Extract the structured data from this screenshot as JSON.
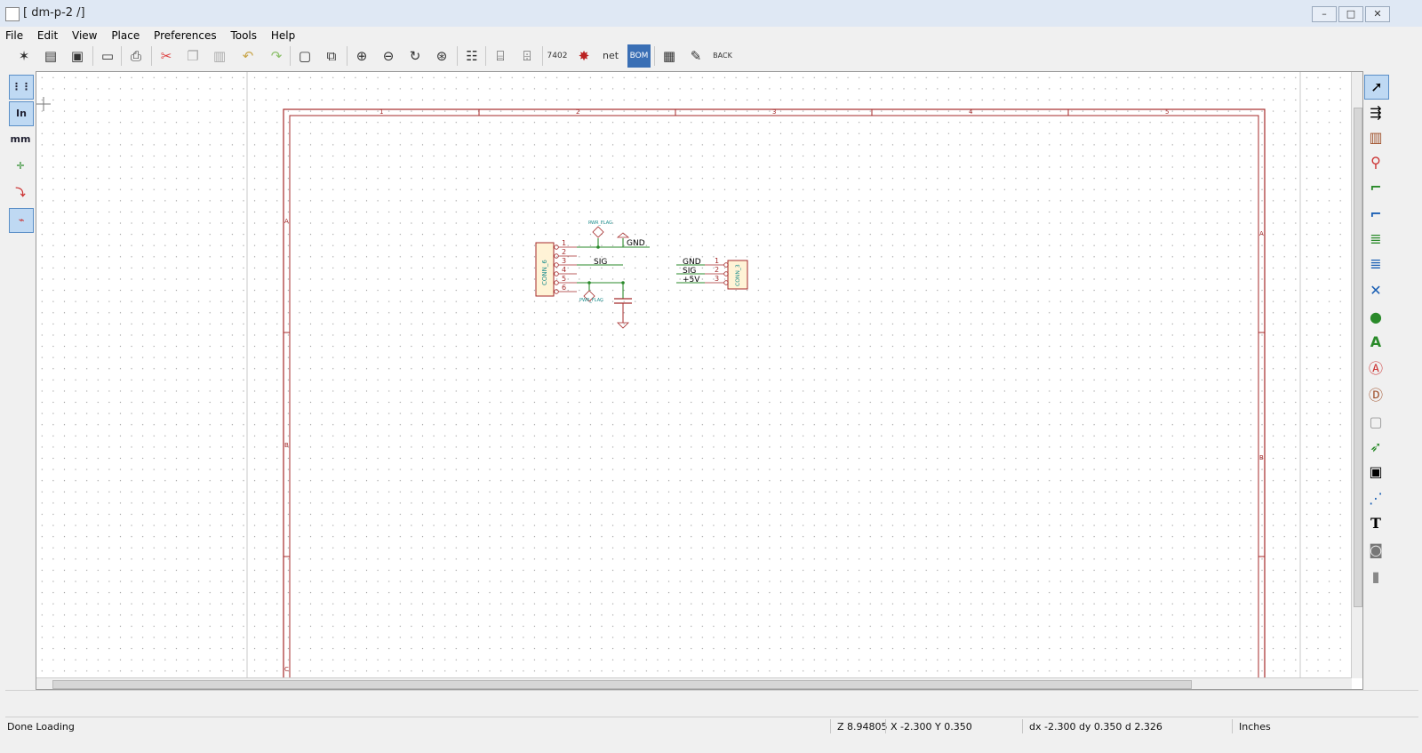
{
  "window": {
    "title": "[ dm-p-2 /]"
  },
  "menu": [
    "File",
    "Edit",
    "View",
    "Place",
    "Preferences",
    "Tools",
    "Help"
  ],
  "toolbar_icons": [
    "new-sheet-icon",
    "open-icon",
    "save-icon",
    "page-settings-icon",
    "print-icon",
    "cut-icon",
    "copy-icon",
    "paste-icon",
    "undo-icon",
    "redo-icon",
    "find-icon",
    "find-replace-icon",
    "zoom-in-icon",
    "zoom-out-icon",
    "redraw-icon",
    "zoom-fit-icon",
    "hierarchy-icon",
    "library-editor-icon",
    "library-browser-icon",
    "annotate-icon",
    "erc-icon",
    "netlist-icon",
    "cvpcb-icon",
    "bom-icon",
    "pcbnew-icon",
    "import-footprint-icon",
    "back-icon"
  ],
  "toolbar_labels": {
    "annotate": "7402",
    "netlist": "net",
    "bom": "BOM",
    "back": "BACK"
  },
  "left_tools": {
    "inches": "In",
    "mm": "mm"
  },
  "schematic": {
    "frame_cols": [
      "1",
      "2",
      "3",
      "4",
      "5"
    ],
    "frame_rows": [
      "A",
      "B",
      "C"
    ],
    "connector1_ref": "CONN_6",
    "connector1_pins": [
      "1",
      "2",
      "3",
      "4",
      "5",
      "6"
    ],
    "connector2_ref": "CONN_3",
    "connector2_pins": [
      "1",
      "2",
      "3"
    ],
    "labels": [
      "GND",
      "SIG",
      "+5V"
    ],
    "net_gnd": "GND",
    "net_sig": "SIG",
    "pwr_flag": "PWR_FLAG"
  },
  "status": {
    "message": "Done Loading",
    "zoom": "Z 8.94805",
    "coords": "X -2.300  Y 0.350",
    "delta": "dx -2.300  dy 0.350  d 2.326",
    "units": "Inches"
  }
}
